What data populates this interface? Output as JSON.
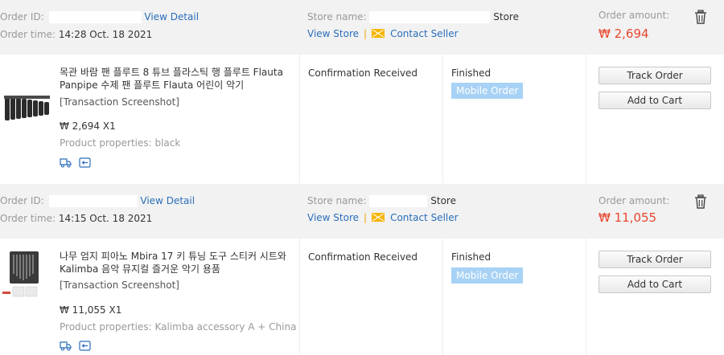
{
  "labels": {
    "order_id": "Order ID:",
    "order_time": "Order time:",
    "store_name": "Store name:",
    "order_amount": "Order amount:",
    "view_detail": "View Detail",
    "view_store": "View Store",
    "contact_seller": "Contact Seller",
    "transaction_screenshot": "[Transaction Screenshot]",
    "product_properties": "Product properties:",
    "track_order": "Track Order",
    "add_to_cart": "Add to Cart"
  },
  "orders": [
    {
      "order_time": "14:28 Oct. 18 2021",
      "store_suffix": "Store",
      "amount": "₩ 2,694",
      "product_title": "목관 바람 팬 플루트 8 튜브 플라스틱 행 플루트 Flauta Panpipe 수제 팬 플루트 Flauta 어린이 악기",
      "price_qty": "₩ 2,694 X1",
      "properties": "black",
      "status": "Confirmation Received",
      "order_state": "Finished",
      "badge": "Mobile Order"
    },
    {
      "order_time": "14:15 Oct. 18 2021",
      "store_suffix": "Store",
      "amount": "₩ 11,055",
      "product_title": "나무 엄지 피아노 Mbira 17 키 튜닝 도구 스티커 시트와 Kalimba 음악 뮤지컬 즐거운 악기 용품",
      "price_qty": "₩ 11,055 X1",
      "properties": "Kalimba accessory A + China",
      "status": "Confirmation Received",
      "order_state": "Finished",
      "badge": "Mobile Order"
    }
  ],
  "colors": {
    "header_bg": "#f2f2f2",
    "link": "#2a6ebb",
    "amount": "#e8452c",
    "badge_bg": "#a8d2f5",
    "mail_icon": "#f7b500"
  },
  "icons": {
    "trash": "trash-icon",
    "mail": "mail-icon",
    "shipping": "shipping-icon",
    "return": "return-icon"
  }
}
